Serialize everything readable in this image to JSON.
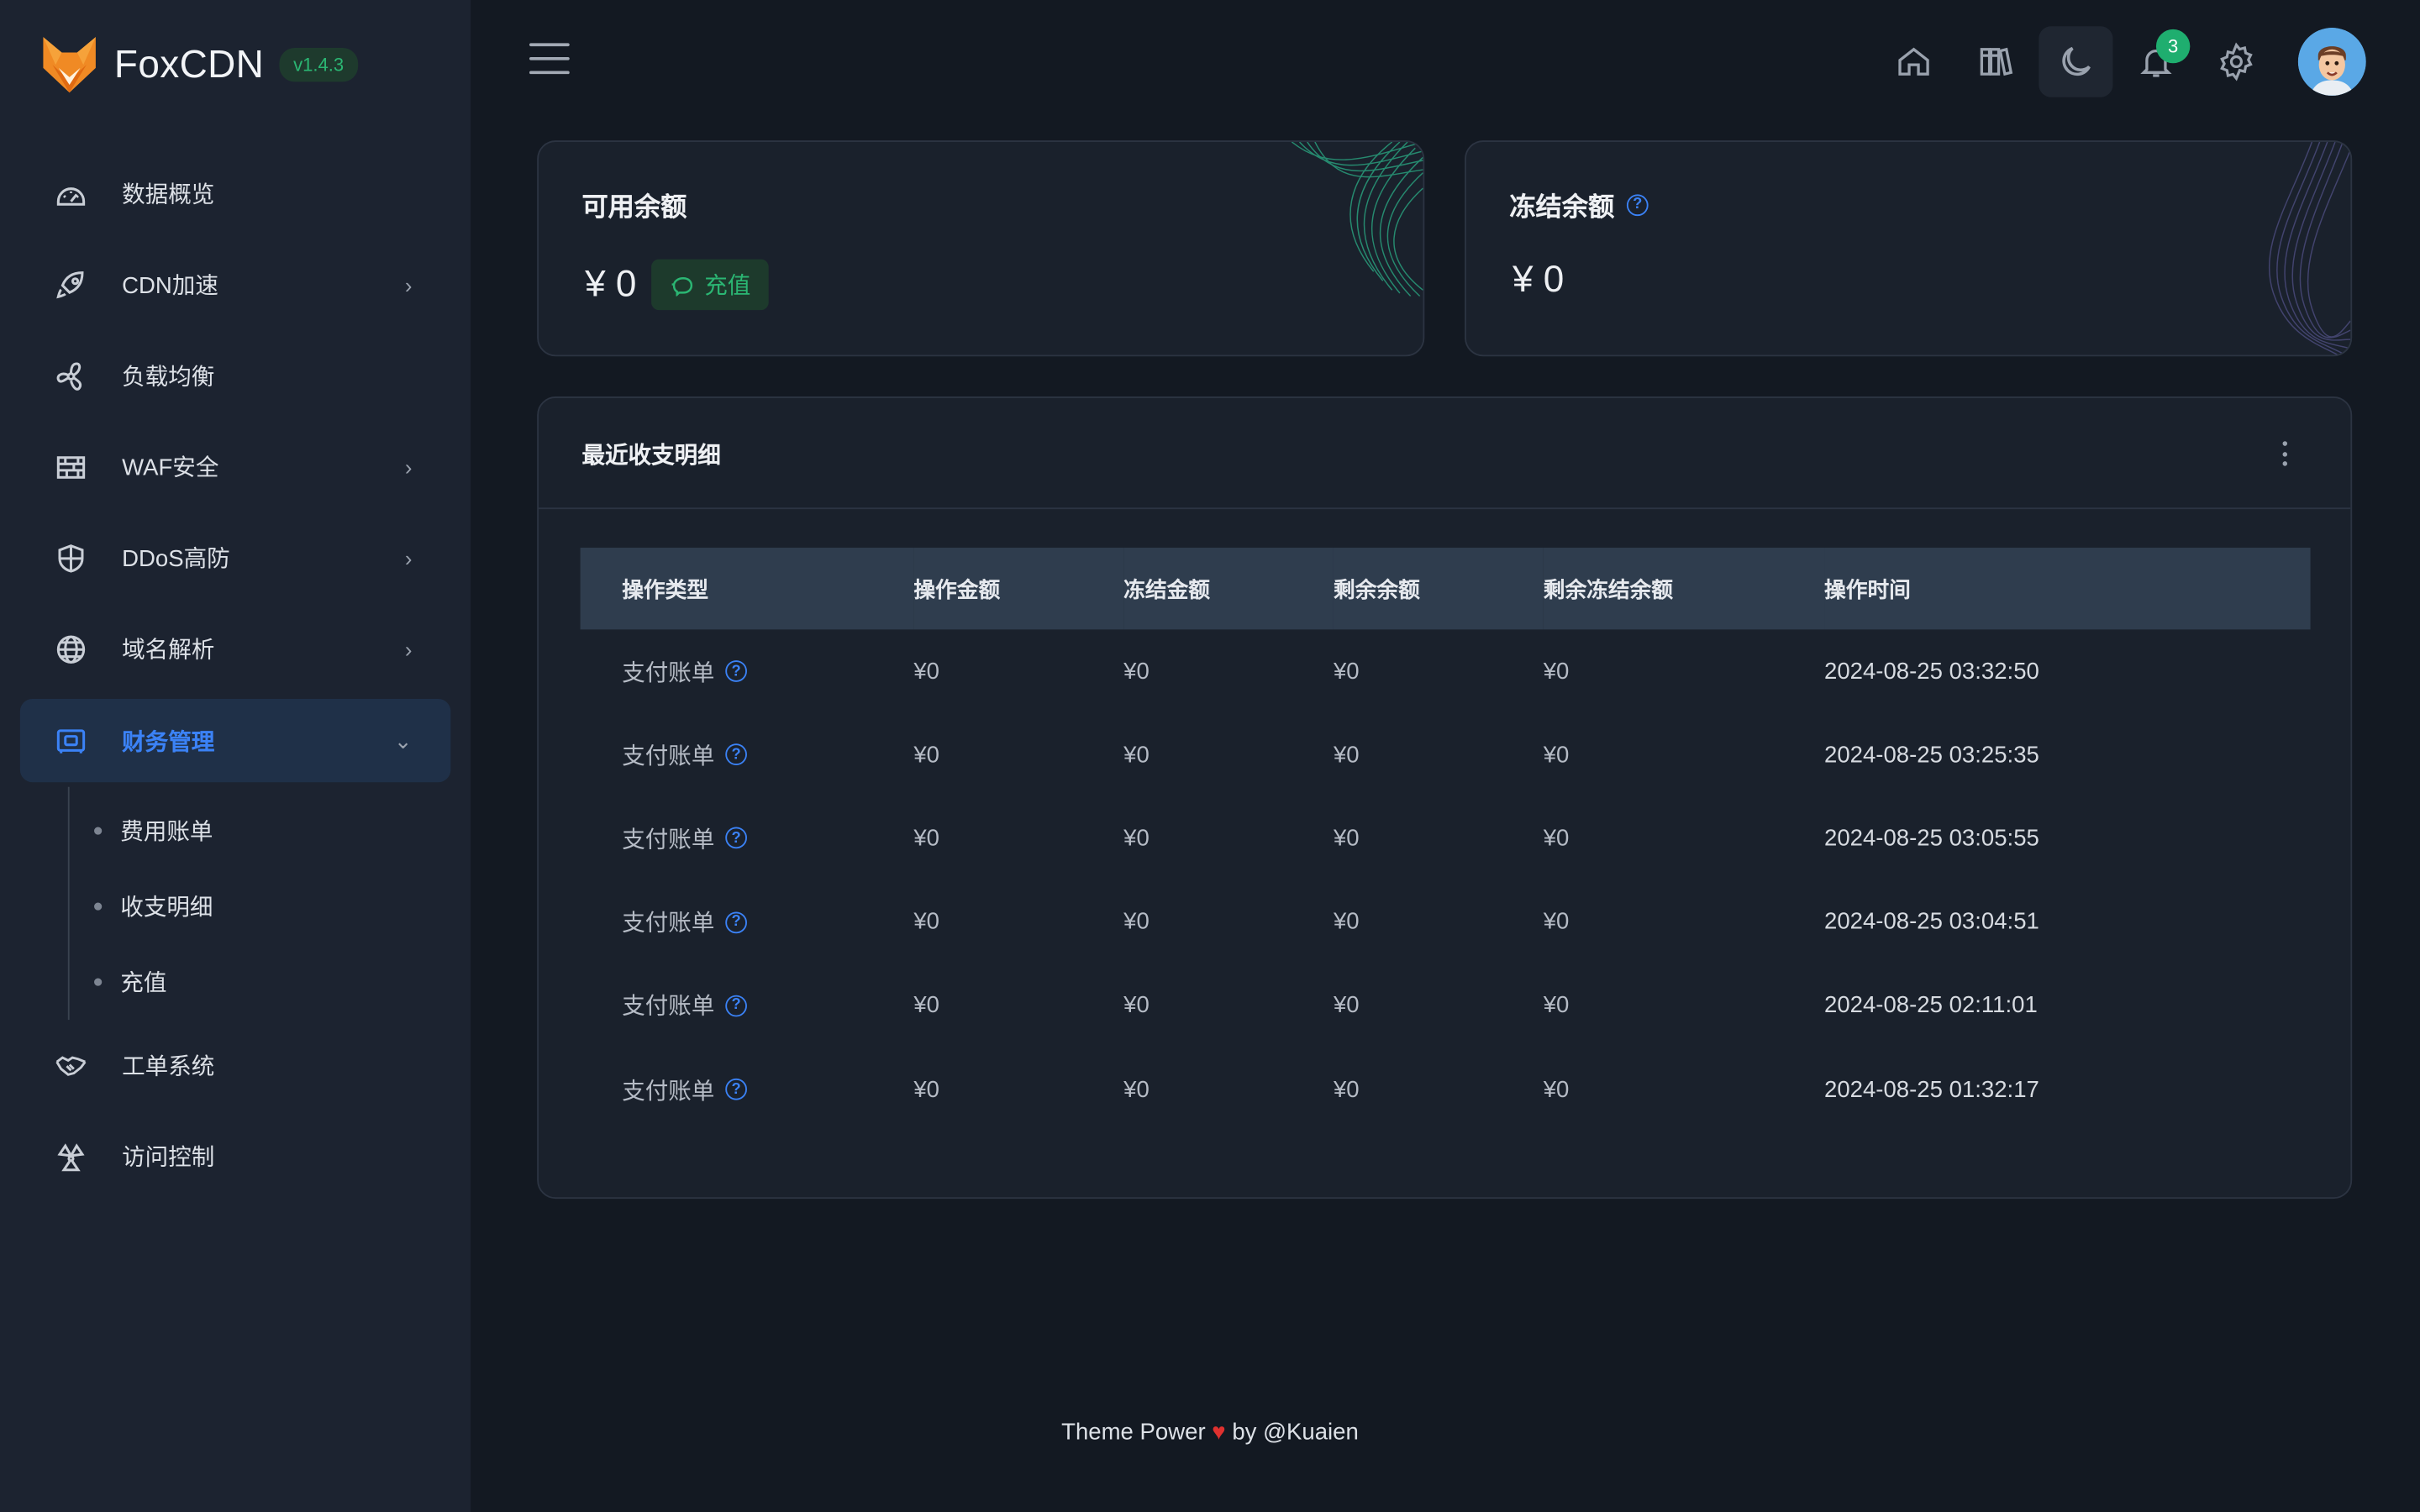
{
  "app": {
    "name": "FoxCDN",
    "version": "v1.4.3"
  },
  "sidebar": {
    "items": [
      {
        "label": "数据概览",
        "icon": "dashboard-icon",
        "has_children": false
      },
      {
        "label": "CDN加速",
        "icon": "rocket-icon",
        "has_children": true
      },
      {
        "label": "负载均衡",
        "icon": "fan-icon",
        "has_children": false
      },
      {
        "label": "WAF安全",
        "icon": "firewall-icon",
        "has_children": true
      },
      {
        "label": "DDoS高防",
        "icon": "shield-icon",
        "has_children": true
      },
      {
        "label": "域名解析",
        "icon": "globe-icon",
        "has_children": true
      },
      {
        "label": "财务管理",
        "icon": "wallet-icon",
        "has_children": true,
        "active": true,
        "expanded": true
      },
      {
        "label": "工单系统",
        "icon": "handshake-icon",
        "has_children": false
      },
      {
        "label": "访问控制",
        "icon": "access-control-icon",
        "has_children": false
      }
    ],
    "finance_sub": [
      "费用账单",
      "收支明细",
      "充值"
    ]
  },
  "topbar": {
    "icons": [
      "menu-icon",
      "home-icon",
      "books-icon",
      "moon-icon",
      "bell-icon",
      "gear-icon",
      "avatar"
    ],
    "notification_count": "3"
  },
  "balance": {
    "available": {
      "title": "可用余额",
      "value": "¥ 0",
      "recharge_label": "充值"
    },
    "frozen": {
      "title": "冻结余额",
      "value": "¥ 0"
    }
  },
  "transactions": {
    "title": "最近收支明细",
    "columns": [
      "操作类型",
      "操作金额",
      "冻结金额",
      "剩余余额",
      "剩余冻结余额",
      "操作时间"
    ],
    "rows": [
      [
        "支付账单",
        "¥0",
        "¥0",
        "¥0",
        "¥0",
        "2024-08-25 03:32:50"
      ],
      [
        "支付账单",
        "¥0",
        "¥0",
        "¥0",
        "¥0",
        "2024-08-25 03:25:35"
      ],
      [
        "支付账单",
        "¥0",
        "¥0",
        "¥0",
        "¥0",
        "2024-08-25 03:05:55"
      ],
      [
        "支付账单",
        "¥0",
        "¥0",
        "¥0",
        "¥0",
        "2024-08-25 03:04:51"
      ],
      [
        "支付账单",
        "¥0",
        "¥0",
        "¥0",
        "¥0",
        "2024-08-25 02:11:01"
      ],
      [
        "支付账单",
        "¥0",
        "¥0",
        "¥0",
        "¥0",
        "2024-08-25 01:32:17"
      ]
    ]
  },
  "footer": {
    "prefix": "Theme Power",
    "heart": "♥",
    "suffix": "by @Kuaien"
  },
  "colors": {
    "accent": "#3b82f6",
    "success": "#2bb673",
    "background": "#131922",
    "sidebar": "#1c2330"
  }
}
